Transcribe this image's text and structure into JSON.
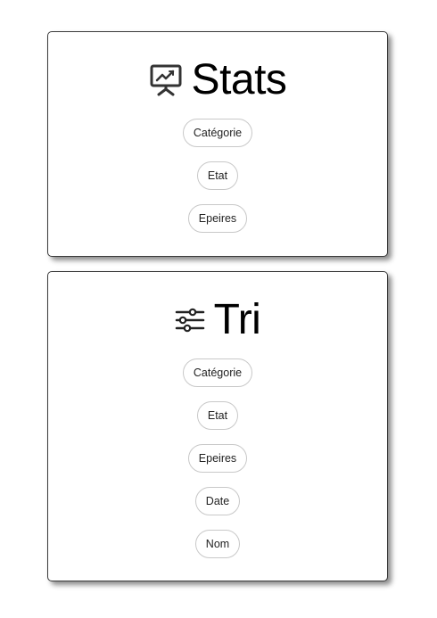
{
  "stats": {
    "icon": "presentation-chart-icon",
    "title": "Stats",
    "buttons": [
      {
        "label": "Catégorie"
      },
      {
        "label": "Etat"
      },
      {
        "label": "Epeires"
      }
    ]
  },
  "tri": {
    "icon": "sliders-icon",
    "title": "Tri",
    "buttons": [
      {
        "label": "Catégorie"
      },
      {
        "label": "Etat"
      },
      {
        "label": "Epeires"
      },
      {
        "label": "Date"
      },
      {
        "label": "Nom"
      }
    ]
  }
}
